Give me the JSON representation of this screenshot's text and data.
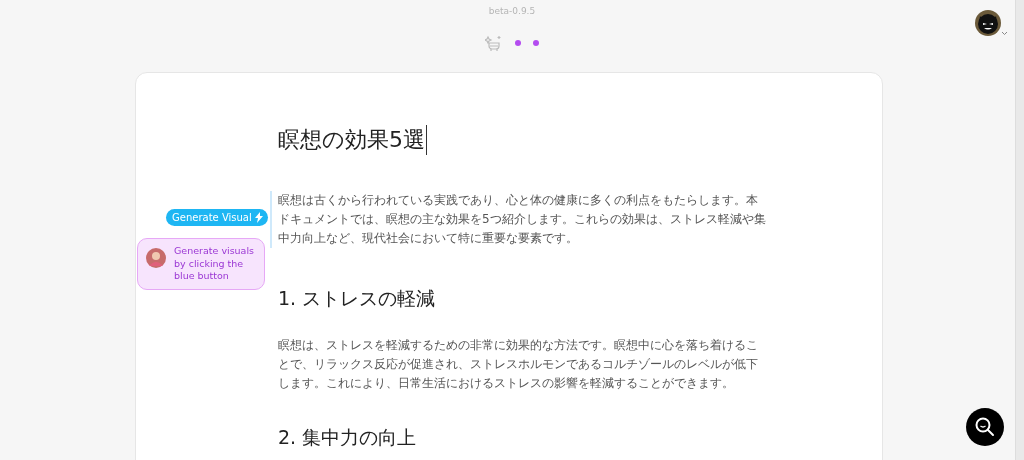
{
  "version": "beta-0.9.5",
  "document": {
    "title": "瞑想の効果5選",
    "blocks": [
      {
        "kind": "paragraph",
        "text": "瞑想は古くから行われている実践であり、心と体の健康に多くの利点をもたらします。本ドキュメントでは、瞑想の主な効果を5つ紹介します。これらの効果は、ストレス軽減や集中力向上など、現代社会において特に重要な要素です。"
      },
      {
        "kind": "heading",
        "text": "1. ストレスの軽減"
      },
      {
        "kind": "paragraph",
        "text": "瞑想は、ストレスを軽減するための非常に効果的な方法です。瞑想中に心を落ち着けることで、リラックス反応が促進され、ストレスホルモンであるコルチゾールのレベルが低下します。これにより、日常生活におけるストレスの影響を軽減することができます。"
      },
      {
        "kind": "heading",
        "text": "2. 集中力の向上"
      }
    ]
  },
  "generate_button": {
    "label": "Generate Visual"
  },
  "hint": {
    "text": "Generate visuals by clicking the blue button"
  }
}
